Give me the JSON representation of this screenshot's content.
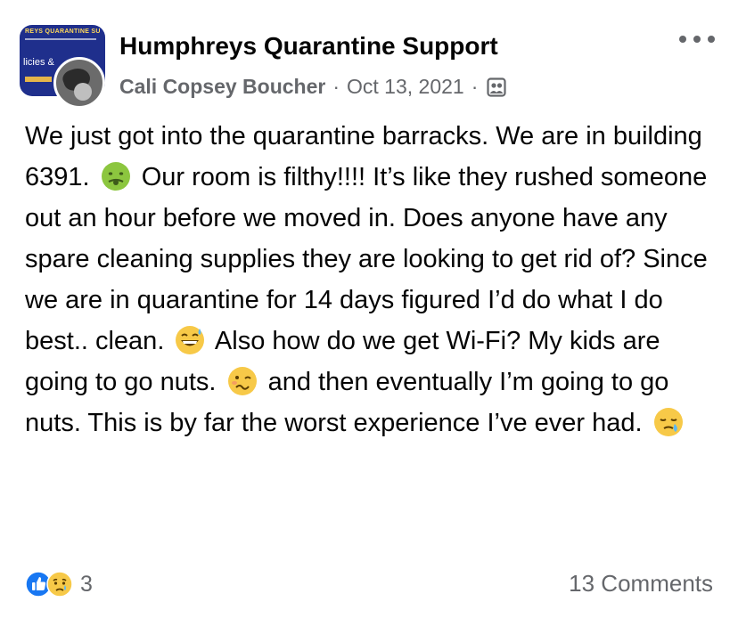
{
  "header": {
    "group_name": "Humphreys Quarantine Support",
    "author": "Cali Copsey Boucher",
    "separator": "·",
    "date": "Oct 13, 2021",
    "separator2": "·",
    "privacy_icon": "group-members-icon",
    "more_icon": "more-options-icon",
    "group_avatar_text_top": "REYS QUARANTINE SU",
    "group_avatar_text_mid": "licies &"
  },
  "post": {
    "seg1": "We just got into the quarantine barracks. We are in building 6391.",
    "emoji1": "nauseated-face",
    "seg2": "Our room is filthy!!!! It’s like they rushed someone out an hour before we moved in. Does anyone have any spare cleaning supplies they are looking to get rid of? Since we are in quarantine for 14 days figured I’d do what I do best.. clean.",
    "emoji2": "grinning-sweat",
    "seg3": "Also how do we get Wi-Fi? My kids are going to go nuts.",
    "emoji3": "woozy-face",
    "seg4": "and then eventually I’m going to go nuts. This is by far the worst experience I’ve ever had.",
    "emoji4": "sleepy-face"
  },
  "footer": {
    "reaction_icons": [
      "like-icon",
      "sad-icon"
    ],
    "reaction_count": "3",
    "comments": "13 Comments"
  },
  "colors": {
    "text": "#050505",
    "secondary": "#65676b",
    "like_blue": "#1877f2",
    "emoji_yellow": "#f7c948"
  }
}
